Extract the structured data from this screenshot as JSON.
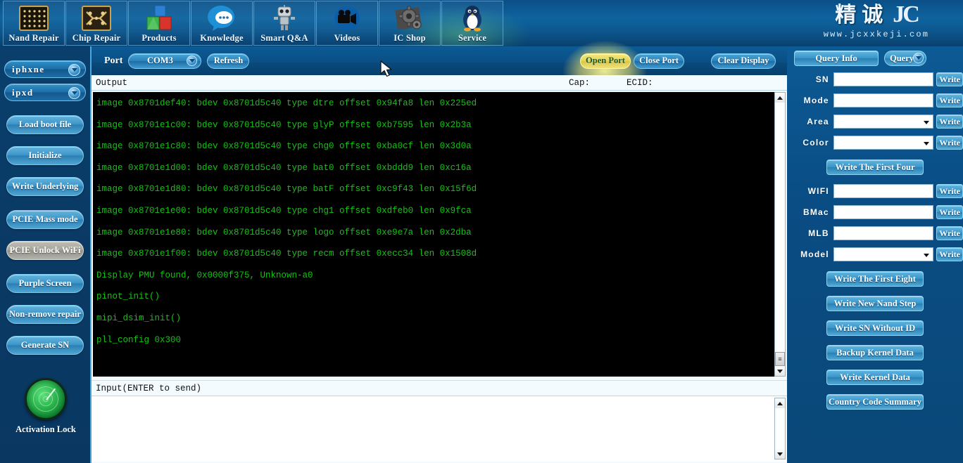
{
  "header": {
    "nav_items": [
      {
        "label": "Nand Repair",
        "icon": "nand-chip-icon"
      },
      {
        "label": "Chip Repair",
        "icon": "circuit-chip-icon"
      },
      {
        "label": "Products",
        "icon": "blocks-icon"
      },
      {
        "label": "Knowledge",
        "icon": "speech-bubble-icon"
      },
      {
        "label": "Smart Q&A",
        "icon": "robot-icon"
      },
      {
        "label": "Videos",
        "icon": "video-camera-icon"
      },
      {
        "label": "IC Shop",
        "icon": "gears-icon"
      },
      {
        "label": "Service",
        "icon": "penguin-icon"
      }
    ],
    "brand_cn": "精诚",
    "brand_jc": "JC",
    "brand_url": "www.jcxxkeji.com"
  },
  "sidebar": {
    "combos": [
      {
        "value": "iphxne"
      },
      {
        "value": "ipxd"
      }
    ],
    "buttons": [
      {
        "label": "Load boot file",
        "state": "normal"
      },
      {
        "label": "Initialize",
        "state": "normal"
      },
      {
        "label": "Write Underlying",
        "state": "normal"
      },
      {
        "label": "PCIE Mass mode",
        "state": "normal"
      },
      {
        "label": "PCIE Unlock WiFi",
        "state": "disabled"
      },
      {
        "label": "Purple Screen",
        "state": "normal"
      },
      {
        "label": "Non-remove repair",
        "state": "normal"
      },
      {
        "label": "Generate SN",
        "state": "normal"
      }
    ],
    "activation_lock_label": "Activation Lock",
    "activation_lock_icon": "radar-lock-icon"
  },
  "toolbar": {
    "port_label": "Port",
    "port_value": "COM3",
    "refresh_label": "Refresh",
    "open_port_label": "Open Port",
    "close_port_label": "Close Port",
    "clear_display_label": "Clear Display",
    "highlight_color": "#efe278"
  },
  "output": {
    "title": "Output",
    "cap_label": "Cap:",
    "ecid_label": "ECID:",
    "text_color": "#15c215",
    "background": "#000000",
    "lines": [
      "image 0x8701def40: bdev 0x8701d5c40 type dtre offset 0x94fa8 len 0x225ed",
      "image 0x8701e1c00: bdev 0x8701d5c40 type glyP offset 0xb7595 len 0x2b3a",
      "image 0x8701e1c80: bdev 0x8701d5c40 type chg0 offset 0xba0cf len 0x3d0a",
      "image 0x8701e1d00: bdev 0x8701d5c40 type bat0 offset 0xbddd9 len 0xc16a",
      "image 0x8701e1d80: bdev 0x8701d5c40 type batF offset 0xc9f43 len 0x15f6d",
      "image 0x8701e1e00: bdev 0x8701d5c40 type chg1 offset 0xdfeb0 len 0x9fca",
      "image 0x8701e1e80: bdev 0x8701d5c40 type logo offset 0xe9e7a len 0x2dba",
      "image 0x8701e1f00: bdev 0x8701d5c40 type recm offset 0xecc34 len 0x1508d",
      "Display PMU found, 0x0000f375, Unknown-a0",
      "pinot_init()",
      "mipi_dsim_init()",
      "pll_config 0x300"
    ]
  },
  "input_panel": {
    "label": "Input(ENTER to send)",
    "value": ""
  },
  "right_panel": {
    "query_info_label": "Query Info",
    "query_label": "Query",
    "write_label": "Write",
    "fields": [
      {
        "label": "SN",
        "value": "",
        "type": "text"
      },
      {
        "label": "Mode",
        "value": "",
        "type": "text"
      },
      {
        "label": "Area",
        "value": "",
        "type": "select"
      },
      {
        "label": "Color",
        "value": "",
        "type": "select"
      }
    ],
    "write_first_four_label": "Write The First Four",
    "fields2": [
      {
        "label": "WIFI",
        "value": "",
        "type": "text"
      },
      {
        "label": "BMac",
        "value": "",
        "type": "text"
      },
      {
        "label": "MLB",
        "value": "",
        "type": "text"
      },
      {
        "label": "Model",
        "value": "",
        "type": "select"
      }
    ],
    "write_first_eight_label": "Write The First Eight",
    "actions": [
      {
        "label": "Write New Nand Step"
      },
      {
        "label": "Write SN Without ID"
      },
      {
        "label": "Backup Kernel Data"
      },
      {
        "label": "Write Kernel Data"
      },
      {
        "label": "Country Code Summary"
      }
    ]
  }
}
